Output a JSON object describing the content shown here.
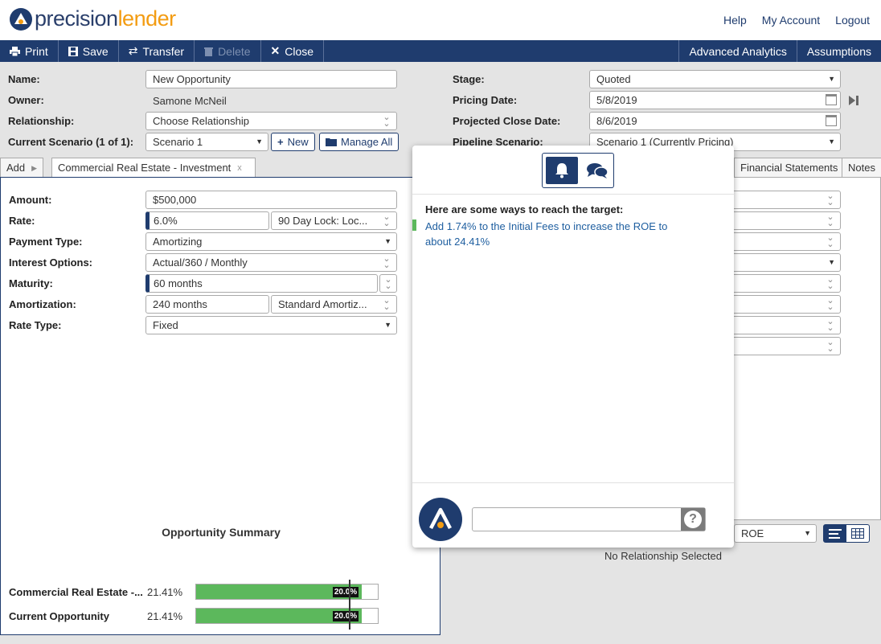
{
  "header": {
    "logo_text_a": "precision",
    "logo_text_b": "lender",
    "links": [
      "Help",
      "My Account",
      "Logout"
    ]
  },
  "toolbar": {
    "print": "Print",
    "save": "Save",
    "transfer": "Transfer",
    "delete": "Delete",
    "close": "Close",
    "advanced_analytics": "Advanced Analytics",
    "assumptions": "Assumptions"
  },
  "form": {
    "name_label": "Name:",
    "name_value": "New Opportunity",
    "owner_label": "Owner:",
    "owner_value": "Samone McNeil",
    "relationship_label": "Relationship:",
    "relationship_value": "Choose Relationship",
    "scenario_label": "Current Scenario (1 of 1):",
    "scenario_value": "Scenario 1",
    "new_label": "New",
    "manage_all_label": "Manage All",
    "stage_label": "Stage:",
    "stage_value": "Quoted",
    "pricing_date_label": "Pricing Date:",
    "pricing_date_value": "5/8/2019",
    "close_date_label": "Projected Close Date:",
    "close_date_value": "8/6/2019",
    "pipeline_label": "Pipeline Scenario:",
    "pipeline_value": "Scenario 1 (Currently Pricing)"
  },
  "tabs": {
    "add": "Add",
    "active": "Commercial Real Estate - Investment",
    "active_close": "x",
    "financial": "Financial Statements",
    "notes": "Notes"
  },
  "loan": {
    "amount_label": "Amount:",
    "amount_value": "$500,000",
    "rate_label": "Rate:",
    "rate_value": "6.0%",
    "rate_lock_value": "90 Day Lock: Loc...",
    "payment_label": "Payment Type:",
    "payment_value": "Amortizing",
    "interest_label": "Interest Options:",
    "interest_value": "Actual/360 / Monthly",
    "maturity_label": "Maturity:",
    "maturity_value": "60 months",
    "amort_label": "Amortization:",
    "amort_value": "240 months",
    "amort_type_value": "Standard Amortiz...",
    "rate_type_label": "Rate Type:",
    "rate_type_value": "Fixed"
  },
  "summary": {
    "title": "Opportunity Summary",
    "rows": [
      {
        "label": "Commercial Real Estate -...",
        "pct": "21.41%",
        "fill": 0.91,
        "target": 0.84,
        "target_label": "20.0%"
      },
      {
        "label": "Current Opportunity",
        "pct": "21.41%",
        "fill": 0.91,
        "target": 0.84,
        "target_label": "20.0%"
      }
    ]
  },
  "assistant": {
    "heading": "Here are some ways to reach the target:",
    "suggestion": "Add 1.74% to the Initial Fees to increase the ROE to about 24.41%",
    "help_label": "?"
  },
  "relationship": {
    "metric_value": "ROE",
    "empty_text": "No Relationship Selected"
  },
  "colors": {
    "brand_navy": "#1f3c6e",
    "brand_orange": "#f39c12",
    "bar_green": "#5cb85c"
  }
}
